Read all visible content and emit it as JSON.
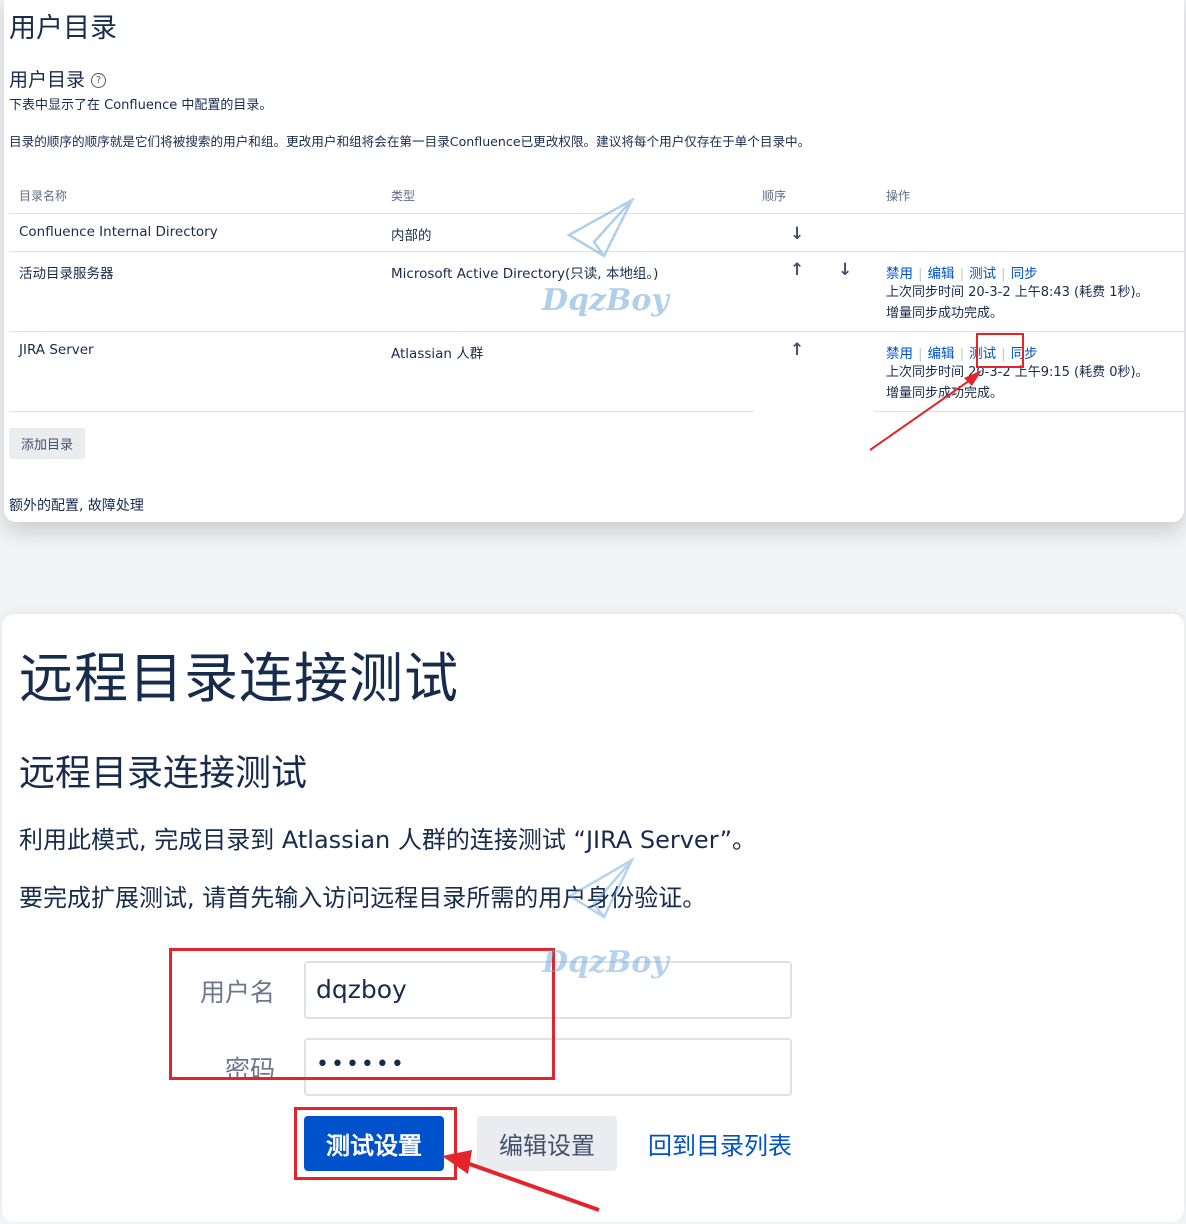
{
  "directory_page": {
    "page_title": "用户目录",
    "section_title": "用户目录",
    "help_icon": "question-circle-icon",
    "description_1": "下表中显示了在 Confluence 中配置的目录。",
    "description_2": "目录的顺序的顺序就是它们将被搜索的用户和组。更改用户和组将会在第一目录Confluence已更改权限。建议将每个用户仅存在于单个目录中。",
    "columns": [
      "目录名称",
      "类型",
      "顺序",
      "操作"
    ],
    "rows": [
      {
        "name": "Confluence Internal Directory",
        "type": "内部的",
        "order": [
          "↓"
        ],
        "actions": [],
        "sync_1": "",
        "sync_2": ""
      },
      {
        "name": "活动目录服务器",
        "type": "Microsoft Active Directory(只读, 本地组。)",
        "order": [
          "↑",
          "↓"
        ],
        "actions": [
          "禁用",
          "编辑",
          "测试",
          "同步"
        ],
        "sync_1": "上次同步时间 20-3-2 上午8:43 (耗费 1秒)。",
        "sync_2": "增量同步成功完成。"
      },
      {
        "name": "JIRA Server",
        "type": "Atlassian 人群",
        "order": [
          "↑"
        ],
        "actions": [
          "禁用",
          "编辑",
          "测试",
          "同步"
        ],
        "sync_1": "上次同步时间 20-3-2 上午9:15 (耗费 0秒)。",
        "sync_2": "增量同步成功完成。"
      }
    ],
    "add_button": "添加目录",
    "footer_text": "额外的配置, 故障处理"
  },
  "connection_test_page": {
    "page_title": "远程目录连接测试",
    "section_title": "远程目录连接测试",
    "paragraph_1": "利用此模式, 完成目录到 Atlassian 人群的连接测试 “JIRA Server”。",
    "paragraph_2": "要完成扩展测试, 请首先输入访问远程目录所需的用户身份验证。",
    "username_label": "用户名",
    "username_value": "dqzboy",
    "password_label": "密码",
    "password_value": "••••••",
    "test_button": "测试设置",
    "edit_button": "编辑设置",
    "back_link": "回到目录列表"
  },
  "watermark": {
    "text": "DqzBoy",
    "icon": "paper-plane-icon"
  },
  "colors": {
    "link": "#0052cc",
    "primary_button": "#0052cc",
    "annotation_red": "#e3242b"
  }
}
